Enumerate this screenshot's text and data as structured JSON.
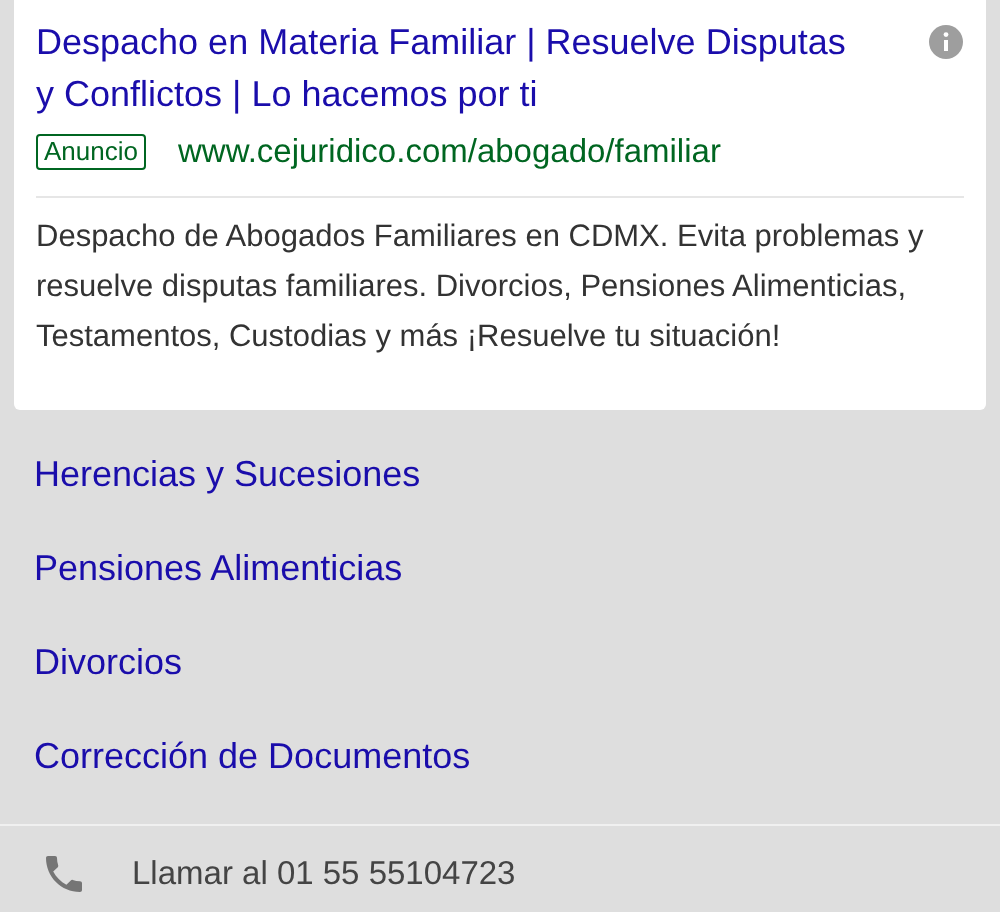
{
  "ad": {
    "title": "Despacho en Materia Familiar | Resuelve Disputas y Conflictos | Lo hacemos por ti",
    "badge": "Anuncio",
    "url": "www.cejuridico.com/abogado/familiar",
    "description": "Despacho de Abogados Familiares en CDMX. Evita problemas y resuelve disputas familiares. Divorcios, Pensiones Alimenticias, Testamentos, Custodias y más ¡Resuelve tu situación!"
  },
  "sitelinks": [
    {
      "label": "Herencias y Sucesiones"
    },
    {
      "label": "Pensiones Alimenticias"
    },
    {
      "label": "Divorcios"
    },
    {
      "label": "Corrección de Documentos"
    }
  ],
  "call": {
    "label": "Llamar al 01 55 55104723"
  }
}
